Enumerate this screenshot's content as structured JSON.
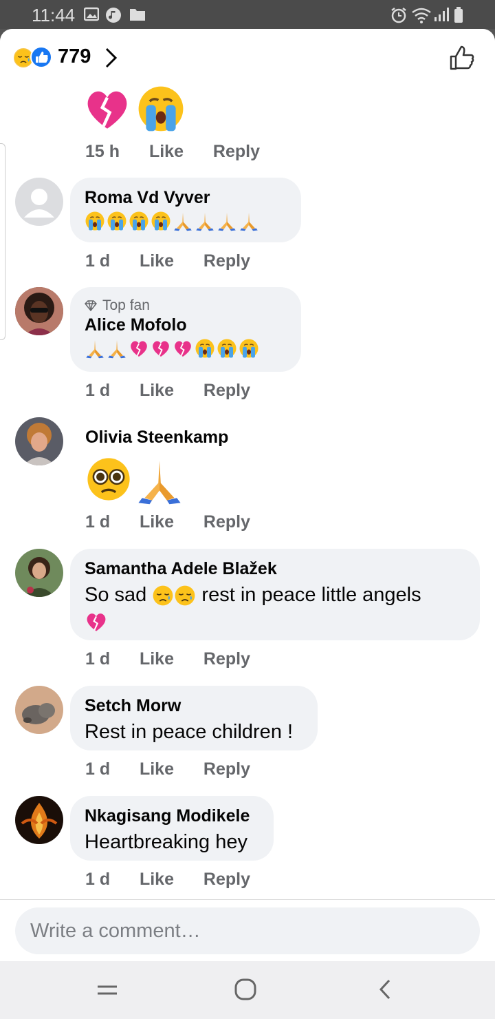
{
  "status": {
    "time": "11:44"
  },
  "header": {
    "reaction_count": "779"
  },
  "comments": [
    {
      "time": "15 h",
      "like": "Like",
      "reply": "Reply"
    },
    {
      "name": "Roma Vd Vyver",
      "time": "1 d",
      "like": "Like",
      "reply": "Reply"
    },
    {
      "badge": "Top fan",
      "name": "Alice Mofolo",
      "time": "1 d",
      "like": "Like",
      "reply": "Reply"
    },
    {
      "name": "Olivia Steenkamp",
      "time": "1 d",
      "like": "Like",
      "reply": "Reply"
    },
    {
      "name": "Samantha Adele Blažek",
      "text": "So sad",
      "text2": "rest in peace little angels",
      "time": "1 d",
      "like": "Like",
      "reply": "Reply"
    },
    {
      "name": "Setch Morw",
      "text": "Rest in peace children !",
      "time": "1 d",
      "like": "Like",
      "reply": "Reply"
    },
    {
      "name": "Nkagisang Modikele",
      "text": "Heartbreaking hey",
      "time": "1 d",
      "like": "Like",
      "reply": "Reply"
    }
  ],
  "composer": {
    "placeholder": "Write a comment…"
  },
  "icons": {
    "gallery": "image-icon",
    "music": "music-icon",
    "folder": "folder-icon",
    "alarm": "alarm-icon",
    "wifi": "wifi-icon",
    "signal": "signal-icon",
    "battery": "battery-icon",
    "reactions": [
      "sad-reaction-icon",
      "like-reaction-icon"
    ],
    "nav": [
      "recent-apps-icon",
      "home-icon",
      "back-icon"
    ]
  },
  "colors": {
    "accent": "#1877f2",
    "bubble": "#f0f2f5",
    "meta": "#65676b",
    "heart": "#e8328a"
  }
}
